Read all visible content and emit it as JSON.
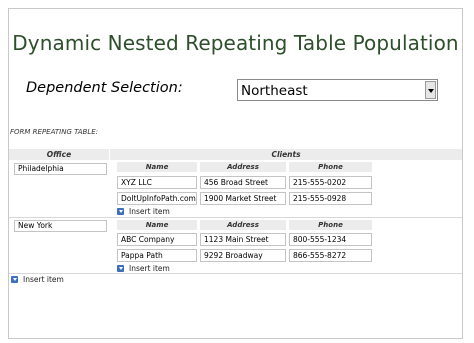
{
  "title": "Dynamic Nested Repeating Table Population",
  "dependent": {
    "label": "Dependent Selection:",
    "value": "Northeast"
  },
  "form_label": "FORM REPEATING TABLE:",
  "table": {
    "headers": {
      "office": "Office",
      "clients": "Clients"
    },
    "nested_headers": {
      "name": "Name",
      "address": "Address",
      "phone": "Phone"
    },
    "rows": [
      {
        "office": "Philadelphia",
        "clients": [
          {
            "name": "XYZ LLC",
            "address": "456 Broad Street",
            "phone": "215-555-0202"
          },
          {
            "name": "DoItUpInfoPath.com",
            "address": "1900 Market Street",
            "phone": "215-555-0928"
          }
        ],
        "insert_label": "Insert item"
      },
      {
        "office": "New York",
        "clients": [
          {
            "name": "ABC Company",
            "address": "1123 Main Street",
            "phone": "800-555-1234"
          },
          {
            "name": "Pappa Path",
            "address": "9292 Broadway",
            "phone": "866-555-8272"
          }
        ],
        "insert_label": "Insert item"
      }
    ],
    "insert_label": "Insert item"
  }
}
